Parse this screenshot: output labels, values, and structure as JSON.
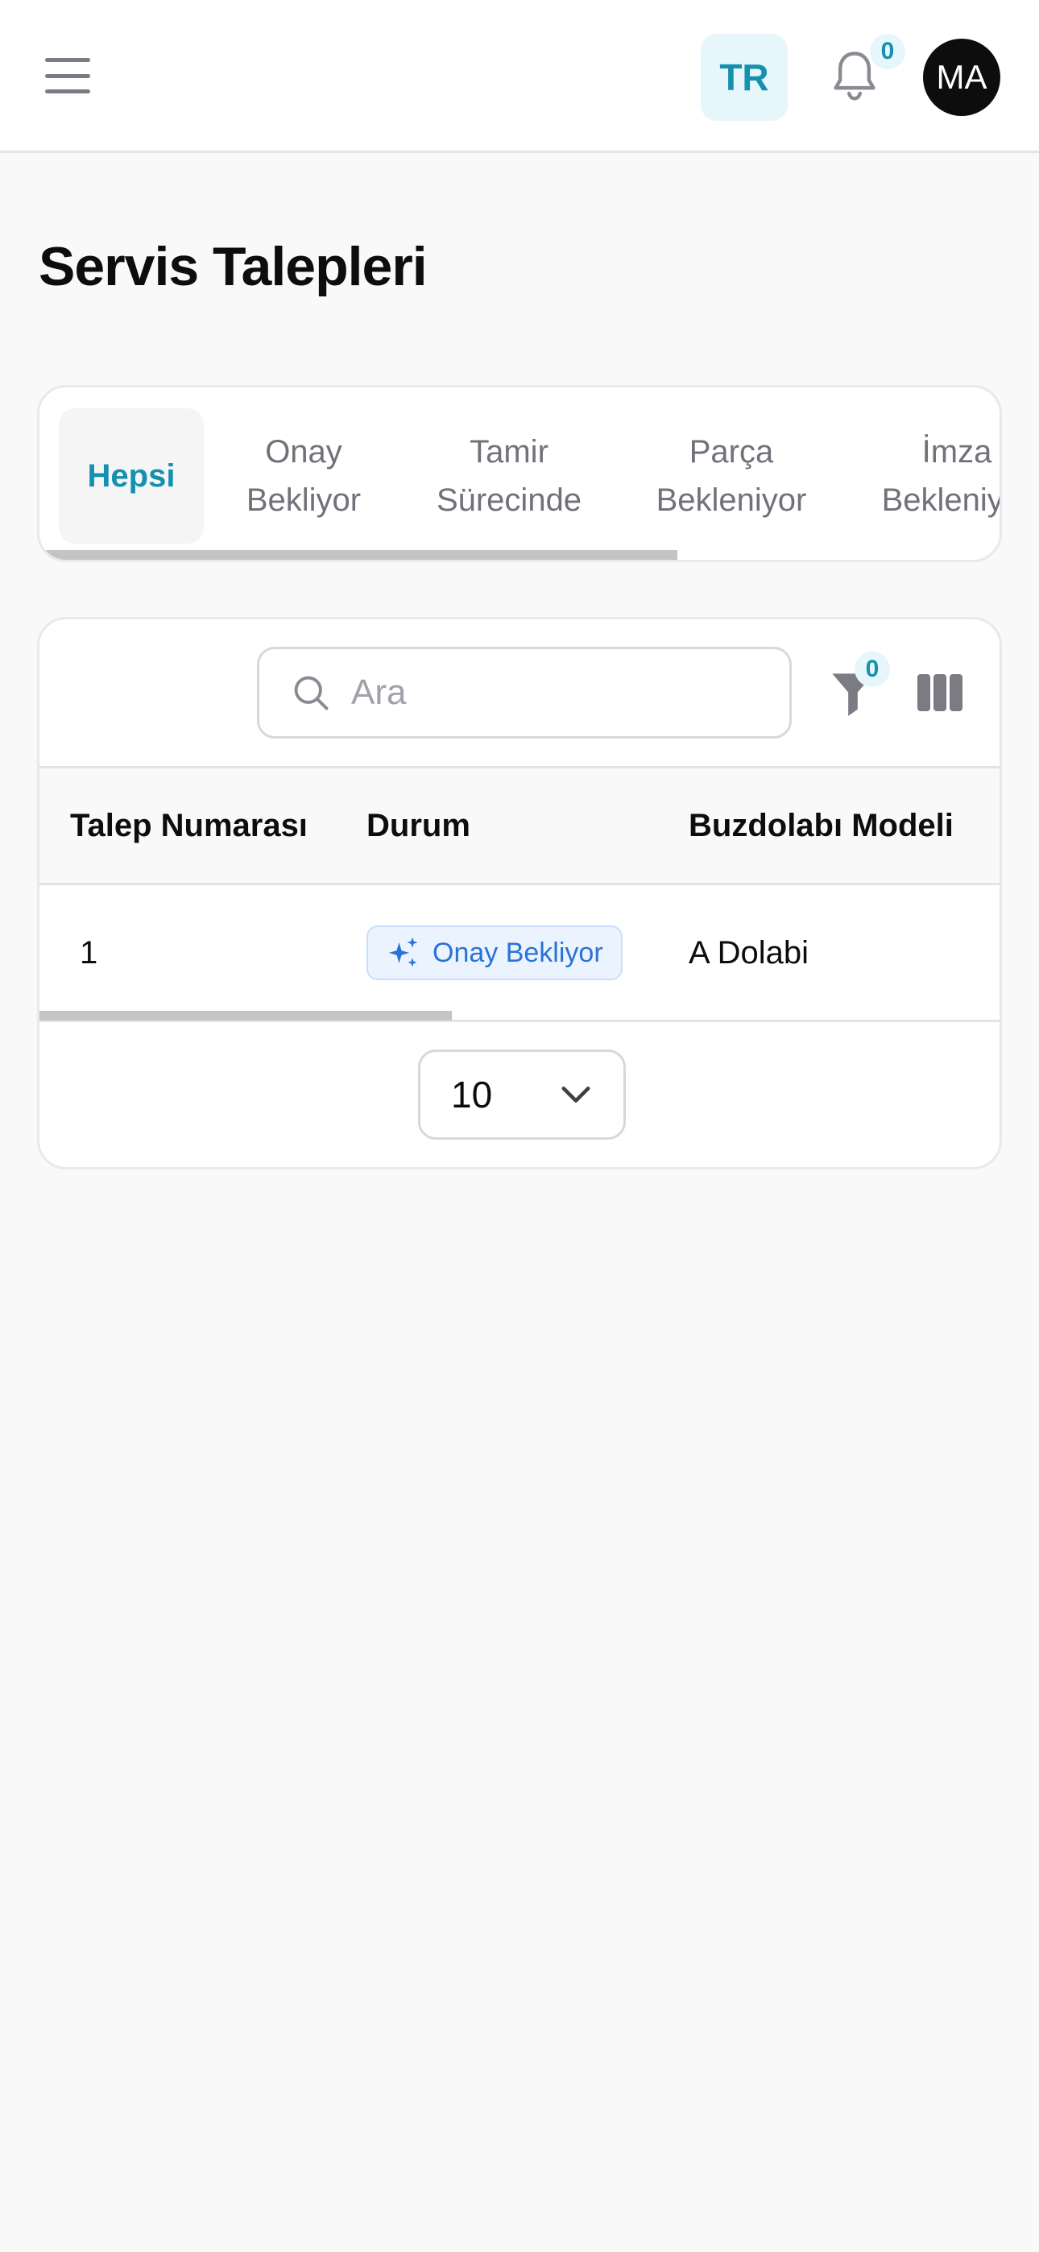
{
  "header": {
    "language": "TR",
    "notification_count": "0",
    "avatar_initials": "MA"
  },
  "page": {
    "title": "Servis Talepleri"
  },
  "tabs": [
    {
      "line1": "Hepsi",
      "line2": "",
      "active": true
    },
    {
      "line1": "Onay",
      "line2": "Bekliyor",
      "active": false
    },
    {
      "line1": "Tamir",
      "line2": "Sürecinde",
      "active": false
    },
    {
      "line1": "Parça",
      "line2": "Bekleniyor",
      "active": false
    },
    {
      "line1": "İmza",
      "line2": "Bekleniyor",
      "active": false
    }
  ],
  "toolbar": {
    "search_placeholder": "Ara",
    "filter_count": "0"
  },
  "table": {
    "columns": [
      "Talep Numarası",
      "Durum",
      "Buzdolabı Modeli"
    ],
    "rows": [
      {
        "id": "1",
        "status": "Onay Bekliyor",
        "model": "A Dolabi"
      }
    ]
  },
  "pagination": {
    "page_size": "10"
  },
  "colors": {
    "accent": "#1591ad",
    "status_blue": "#2b72d6",
    "background": "#f9f9f9"
  }
}
